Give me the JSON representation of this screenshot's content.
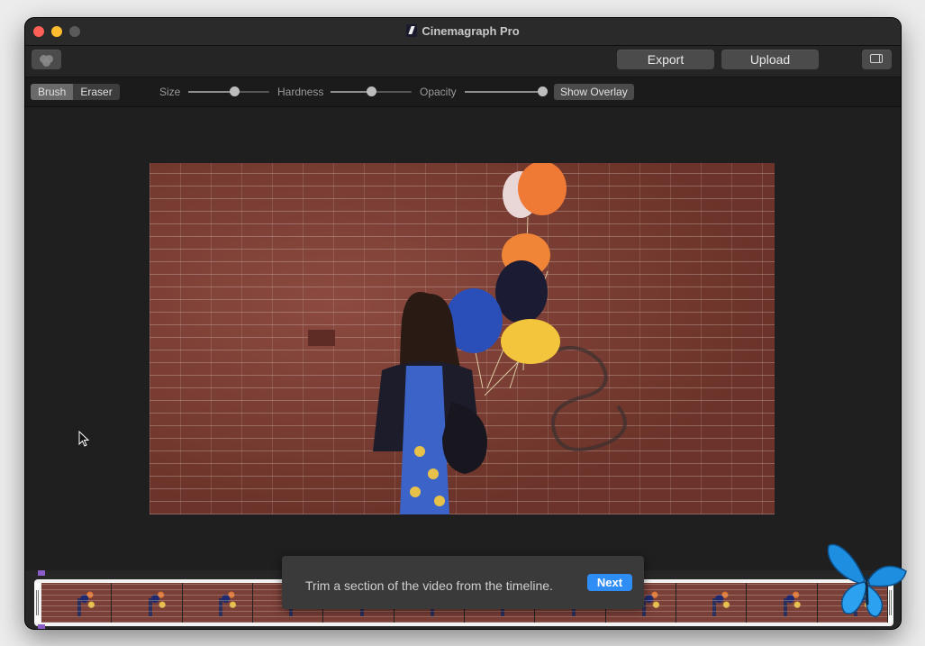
{
  "window": {
    "title": "Cinemagraph Pro"
  },
  "toolbar": {
    "effects_icon": "overlapping-circles-icon",
    "export_label": "Export",
    "upload_label": "Upload",
    "sidebar_icon": "sidebar-toggle-icon"
  },
  "brush_bar": {
    "modes": [
      {
        "label": "Brush",
        "selected": true
      },
      {
        "label": "Eraser",
        "selected": false
      }
    ],
    "size": {
      "label": "Size",
      "value": 0.57
    },
    "hardness": {
      "label": "Hardness",
      "value": 0.5
    },
    "opacity": {
      "label": "Opacity",
      "value": 0.95
    },
    "overlay_label": "Show Overlay"
  },
  "preview": {
    "description_icon": "video-frame"
  },
  "tooltip": {
    "message": "Trim a section of the video from the timeline.",
    "next_label": "Next"
  },
  "timeline": {
    "frame_count": 12
  },
  "colors": {
    "accent": "#2f8ef5",
    "playhead": "#8a5cc8"
  }
}
